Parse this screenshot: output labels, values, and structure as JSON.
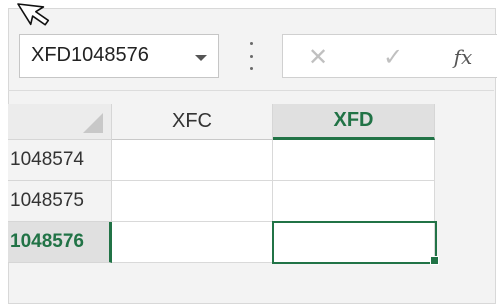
{
  "name_box": {
    "value": "XFD1048576"
  },
  "formula_bar": {
    "cancel_glyph": "✕",
    "enter_glyph": "✓",
    "fx_label": "fx"
  },
  "columns": [
    {
      "label": "XFC",
      "selected": false
    },
    {
      "label": "XFD",
      "selected": true
    }
  ],
  "rows": [
    {
      "label": "1048574",
      "selected": false
    },
    {
      "label": "1048575",
      "selected": false
    },
    {
      "label": "1048576",
      "selected": true
    }
  ],
  "active_cell": "XFD1048576",
  "colors": {
    "accent": "#217346",
    "header_bg": "#f3f3f3",
    "selected_header_bg": "#e0e0e0"
  },
  "icons": [
    "mouse-pointer-icon",
    "dropdown-arrow-icon",
    "more-options-icon",
    "cancel-icon",
    "enter-icon",
    "insert-function-icon",
    "select-all-icon"
  ]
}
